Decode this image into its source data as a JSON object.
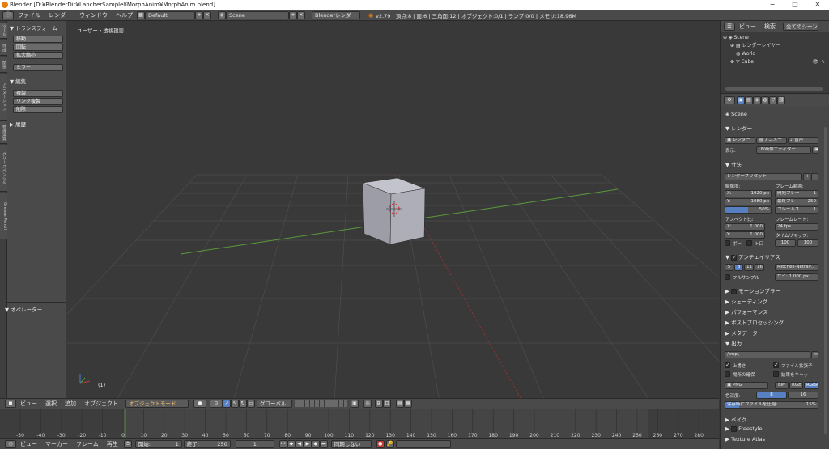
{
  "window": {
    "title": "Blender [D:¥BlenderDir¥LancherSample¥MorphAnim¥MorphAnim.blend]",
    "controls": [
      "−",
      "□",
      "✕"
    ]
  },
  "menubar": {
    "menus": [
      "ファイル",
      "レンダー",
      "ウィンドウ",
      "ヘルプ"
    ],
    "layout": "Default",
    "scene": "Scene",
    "engine": "Blenderレンダー",
    "info": "v2.79 | 頂点:8 | 面:6 | 三角面:12 | オブジェクト:0/1 | ランプ:0/0 | メモリ:18.96M"
  },
  "toolshelf": {
    "tabs": [
      "ツール",
      "作成",
      "関係",
      "アニメーション",
      "物理演算",
      "グリースペンシル",
      "Grease Pencil"
    ],
    "transform_header": "▼ トランスフォーム",
    "transform_buttons": [
      "移動",
      "回転",
      "拡大縮小"
    ],
    "mirror": "ミラー",
    "edit_header": "▼ 編集",
    "edit_buttons": [
      "複製",
      "リンク複製",
      "削除"
    ],
    "history_header": "▶ 履歴",
    "operator_header": "▼ オペレーター"
  },
  "viewport": {
    "label": "ユーザー・透視投影",
    "frame": "(1)"
  },
  "header3d": {
    "menus": [
      "ビュー",
      "選択",
      "追加",
      "オブジェクト"
    ],
    "mode": "オブジェクトモード",
    "orientation": "グローバル"
  },
  "timeline": {
    "ticks": [
      "-50",
      "-40",
      "-30",
      "-20",
      "-10",
      "0",
      "10",
      "20",
      "30",
      "40",
      "50",
      "60",
      "70",
      "80",
      "90",
      "100",
      "110",
      "120",
      "130",
      "140",
      "150",
      "160",
      "170",
      "180",
      "190",
      "200",
      "210",
      "220",
      "230",
      "240",
      "250",
      "260",
      "270",
      "280"
    ],
    "current_frame": 1
  },
  "timeline_header": {
    "menus": [
      "ビュー",
      "マーカー",
      "フレーム",
      "再生"
    ],
    "start_label": "開始:",
    "start": "1",
    "end_label": "終了:",
    "end": "250",
    "current": "1",
    "sync": "同期しない"
  },
  "outliner": {
    "menus": [
      "ビュー",
      "検索"
    ],
    "filter": "全てのシーン",
    "items": [
      "Scene",
      "レンダーレイヤー",
      "World",
      "Cube"
    ]
  },
  "properties": {
    "scene": "Scene",
    "render_header": "▼ レンダー",
    "render_btn": "レンダー",
    "anim_btn": "アニメー",
    "audio_btn": "音声",
    "display_label": "表示:",
    "display_value": "UV画像エディター",
    "dims_header": "▼ 寸法",
    "preset": "レンダープリセット",
    "res_label": "解像度:",
    "res_x": "X:",
    "res_x_val": "1920 px",
    "res_y": "Y:",
    "res_y_val": "1080 px",
    "res_pct": "50%",
    "frame_range_label": "フレーム範囲:",
    "start_label": "開始フレー",
    "start_val": "1",
    "end_label": "最終フレ",
    "end_val": "250",
    "step_label": "フレームス",
    "step_val": "1",
    "aspect_label": "アスペクト比:",
    "asp_x": "X:",
    "asp_x_val": "1.000",
    "asp_y": "Y:",
    "asp_y_val": "1.000",
    "fps_label": "フレームレート:",
    "fps": "24 fps",
    "remap_label": "タイムリマップ:",
    "remap_a": "100",
    "remap_b": "100",
    "border": "ボー",
    "crop": "ト口",
    "aa_header": "アンチエイリアス",
    "aa_samples": [
      "5",
      "8",
      "11",
      "16"
    ],
    "aa_filter": "Mitchell-Netrav...",
    "full_sample": "フルサンプル",
    "size": "サイ: 1.000 px",
    "collapsed": [
      "モーションブラー",
      "シェーディング",
      "パフォーマンス",
      "ポストプロセッシング",
      "メタデータ"
    ],
    "output_header": "▼ 出力",
    "output_path": "/tmp\\",
    "overwrite": "上書き",
    "file_ext": "ファイル拡張子",
    "placeholders": "場所の確保",
    "cache": "結果をキャッ",
    "format": "PNG",
    "bw": "BW",
    "rgb": "RGB",
    "rgba": "RGBA",
    "depth_label": "色深度:",
    "depth_8": "8",
    "depth_16": "16",
    "compress": "保存時にファイルを圧縮:",
    "compress_val": "15%",
    "bake": "▶ ベイク",
    "freestyle": "Freestyle",
    "textatlas": "Texture Atlas"
  }
}
